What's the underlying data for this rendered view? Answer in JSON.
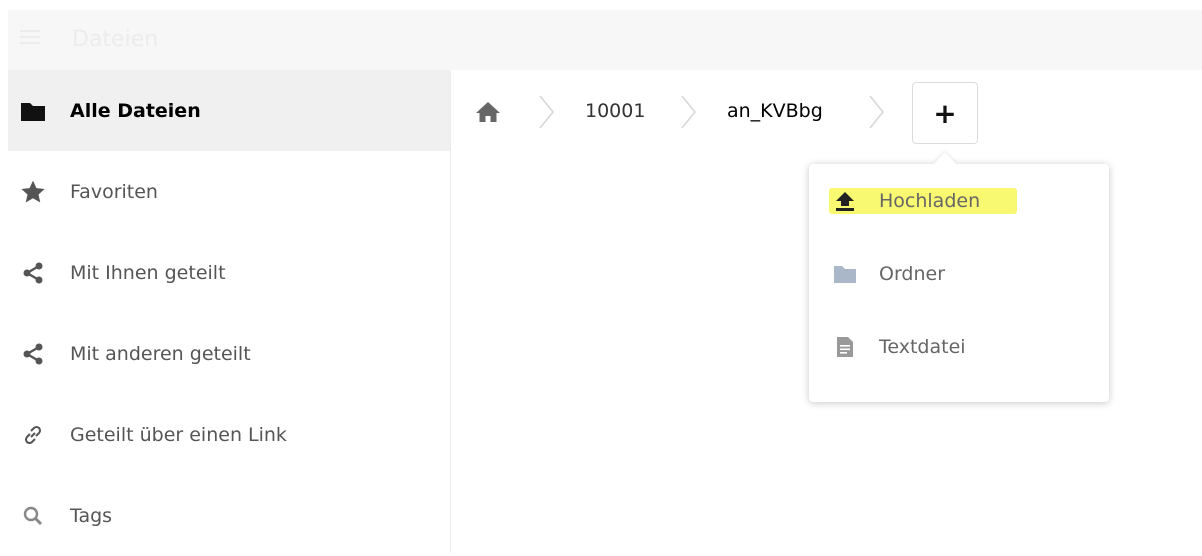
{
  "app": {
    "title": "Dateien"
  },
  "sidebar": {
    "items": [
      {
        "label": "Alle Dateien",
        "icon": "folder-icon",
        "active": true
      },
      {
        "label": "Favoriten",
        "icon": "star-icon"
      },
      {
        "label": "Mit Ihnen geteilt",
        "icon": "share-icon"
      },
      {
        "label": "Mit anderen geteilt",
        "icon": "share-icon"
      },
      {
        "label": "Geteilt über einen Link",
        "icon": "link-icon"
      },
      {
        "label": "Tags",
        "icon": "search-icon"
      }
    ]
  },
  "breadcrumb": {
    "home_icon": "home-icon",
    "items": [
      {
        "label": "10001"
      },
      {
        "label": "an_KVBbg"
      }
    ],
    "add_label": "+"
  },
  "new_menu": {
    "items": [
      {
        "label": "Hochladen",
        "icon": "upload-icon",
        "highlight": "#f9f871"
      },
      {
        "label": "Ordner",
        "icon": "folder-icon"
      },
      {
        "label": "Textdatei",
        "icon": "text-file-icon"
      }
    ]
  },
  "colors": {
    "folder_light": "#a9b7c9",
    "icon_dark": "#111111",
    "icon_gray": "#666666",
    "highlight": "#f9f871"
  }
}
